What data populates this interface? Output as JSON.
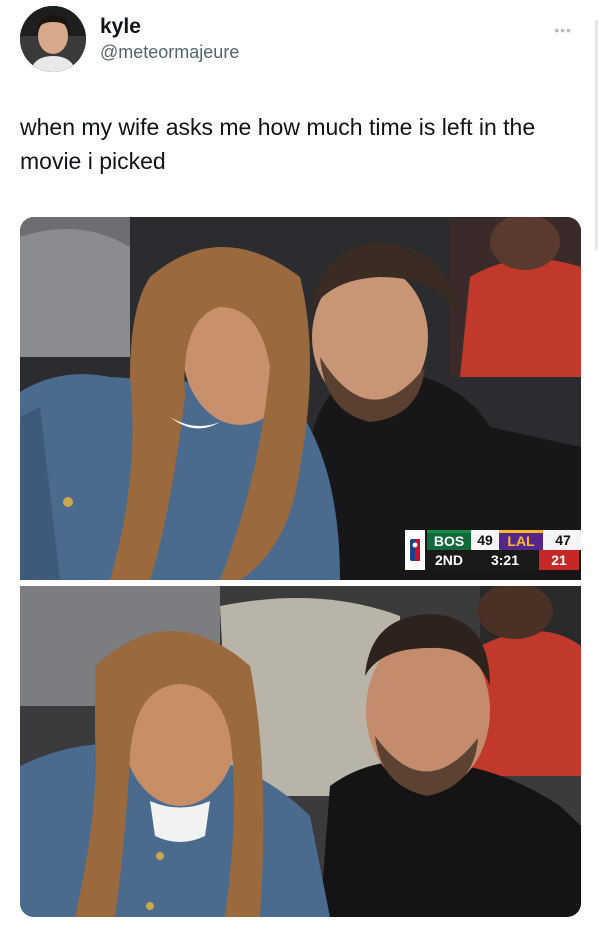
{
  "tweet": {
    "display_name": "kyle",
    "handle": "@meteormajeure",
    "more_icon": "more-options-icon",
    "text": "when my wife asks me how much time is left in the movie i picked"
  },
  "scorebug": {
    "home_team": "BOS",
    "home_score": "49",
    "away_team": "LAL",
    "away_score": "47",
    "period": "2ND",
    "clock": "3:21",
    "shot_clock": "21",
    "colors": {
      "bos": "#0f6b3a",
      "lal": "#55278a",
      "lal_gold": "#fdb927",
      "shot": "#c62828"
    }
  }
}
